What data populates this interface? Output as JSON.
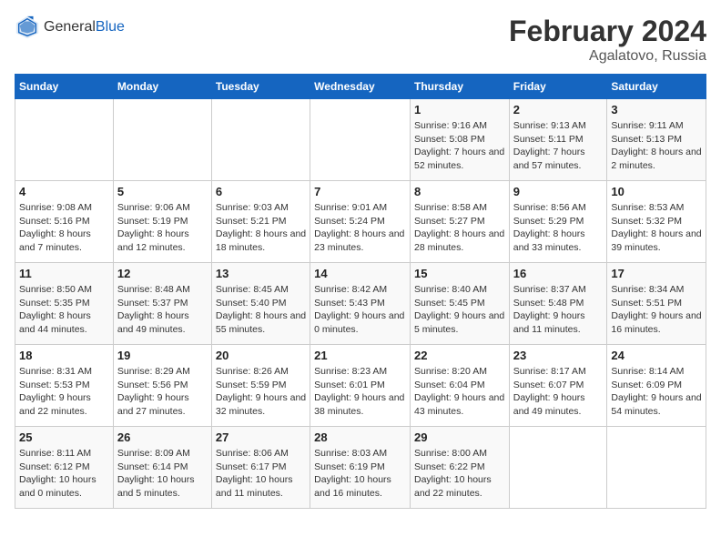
{
  "header": {
    "logo_general": "General",
    "logo_blue": "Blue",
    "month_title": "February 2024",
    "location": "Agalatovo, Russia"
  },
  "weekdays": [
    "Sunday",
    "Monday",
    "Tuesday",
    "Wednesday",
    "Thursday",
    "Friday",
    "Saturday"
  ],
  "weeks": [
    [
      {
        "day": "",
        "info": ""
      },
      {
        "day": "",
        "info": ""
      },
      {
        "day": "",
        "info": ""
      },
      {
        "day": "",
        "info": ""
      },
      {
        "day": "1",
        "info": "Sunrise: 9:16 AM\nSunset: 5:08 PM\nDaylight: 7 hours and 52 minutes."
      },
      {
        "day": "2",
        "info": "Sunrise: 9:13 AM\nSunset: 5:11 PM\nDaylight: 7 hours and 57 minutes."
      },
      {
        "day": "3",
        "info": "Sunrise: 9:11 AM\nSunset: 5:13 PM\nDaylight: 8 hours and 2 minutes."
      }
    ],
    [
      {
        "day": "4",
        "info": "Sunrise: 9:08 AM\nSunset: 5:16 PM\nDaylight: 8 hours and 7 minutes."
      },
      {
        "day": "5",
        "info": "Sunrise: 9:06 AM\nSunset: 5:19 PM\nDaylight: 8 hours and 12 minutes."
      },
      {
        "day": "6",
        "info": "Sunrise: 9:03 AM\nSunset: 5:21 PM\nDaylight: 8 hours and 18 minutes."
      },
      {
        "day": "7",
        "info": "Sunrise: 9:01 AM\nSunset: 5:24 PM\nDaylight: 8 hours and 23 minutes."
      },
      {
        "day": "8",
        "info": "Sunrise: 8:58 AM\nSunset: 5:27 PM\nDaylight: 8 hours and 28 minutes."
      },
      {
        "day": "9",
        "info": "Sunrise: 8:56 AM\nSunset: 5:29 PM\nDaylight: 8 hours and 33 minutes."
      },
      {
        "day": "10",
        "info": "Sunrise: 8:53 AM\nSunset: 5:32 PM\nDaylight: 8 hours and 39 minutes."
      }
    ],
    [
      {
        "day": "11",
        "info": "Sunrise: 8:50 AM\nSunset: 5:35 PM\nDaylight: 8 hours and 44 minutes."
      },
      {
        "day": "12",
        "info": "Sunrise: 8:48 AM\nSunset: 5:37 PM\nDaylight: 8 hours and 49 minutes."
      },
      {
        "day": "13",
        "info": "Sunrise: 8:45 AM\nSunset: 5:40 PM\nDaylight: 8 hours and 55 minutes."
      },
      {
        "day": "14",
        "info": "Sunrise: 8:42 AM\nSunset: 5:43 PM\nDaylight: 9 hours and 0 minutes."
      },
      {
        "day": "15",
        "info": "Sunrise: 8:40 AM\nSunset: 5:45 PM\nDaylight: 9 hours and 5 minutes."
      },
      {
        "day": "16",
        "info": "Sunrise: 8:37 AM\nSunset: 5:48 PM\nDaylight: 9 hours and 11 minutes."
      },
      {
        "day": "17",
        "info": "Sunrise: 8:34 AM\nSunset: 5:51 PM\nDaylight: 9 hours and 16 minutes."
      }
    ],
    [
      {
        "day": "18",
        "info": "Sunrise: 8:31 AM\nSunset: 5:53 PM\nDaylight: 9 hours and 22 minutes."
      },
      {
        "day": "19",
        "info": "Sunrise: 8:29 AM\nSunset: 5:56 PM\nDaylight: 9 hours and 27 minutes."
      },
      {
        "day": "20",
        "info": "Sunrise: 8:26 AM\nSunset: 5:59 PM\nDaylight: 9 hours and 32 minutes."
      },
      {
        "day": "21",
        "info": "Sunrise: 8:23 AM\nSunset: 6:01 PM\nDaylight: 9 hours and 38 minutes."
      },
      {
        "day": "22",
        "info": "Sunrise: 8:20 AM\nSunset: 6:04 PM\nDaylight: 9 hours and 43 minutes."
      },
      {
        "day": "23",
        "info": "Sunrise: 8:17 AM\nSunset: 6:07 PM\nDaylight: 9 hours and 49 minutes."
      },
      {
        "day": "24",
        "info": "Sunrise: 8:14 AM\nSunset: 6:09 PM\nDaylight: 9 hours and 54 minutes."
      }
    ],
    [
      {
        "day": "25",
        "info": "Sunrise: 8:11 AM\nSunset: 6:12 PM\nDaylight: 10 hours and 0 minutes."
      },
      {
        "day": "26",
        "info": "Sunrise: 8:09 AM\nSunset: 6:14 PM\nDaylight: 10 hours and 5 minutes."
      },
      {
        "day": "27",
        "info": "Sunrise: 8:06 AM\nSunset: 6:17 PM\nDaylight: 10 hours and 11 minutes."
      },
      {
        "day": "28",
        "info": "Sunrise: 8:03 AM\nSunset: 6:19 PM\nDaylight: 10 hours and 16 minutes."
      },
      {
        "day": "29",
        "info": "Sunrise: 8:00 AM\nSunset: 6:22 PM\nDaylight: 10 hours and 22 minutes."
      },
      {
        "day": "",
        "info": ""
      },
      {
        "day": "",
        "info": ""
      }
    ]
  ]
}
